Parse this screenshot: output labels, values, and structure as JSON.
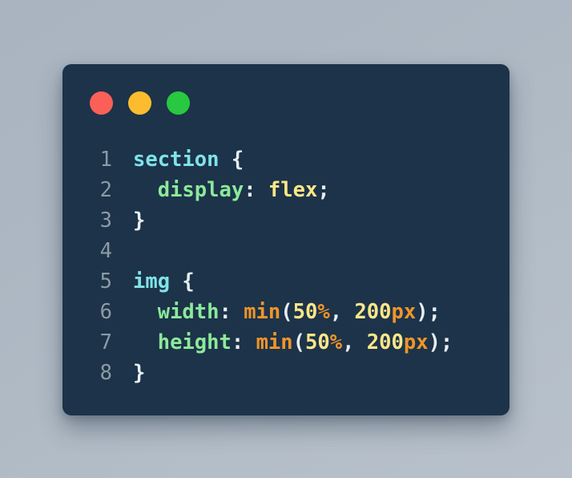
{
  "window": {
    "controls": [
      {
        "name": "close",
        "color": "#fb6058"
      },
      {
        "name": "minimize",
        "color": "#fdbc2e"
      },
      {
        "name": "zoom",
        "color": "#28c840"
      }
    ],
    "background": "#1c3349"
  },
  "theme": {
    "page_gradient_from": "#a9b4c0",
    "page_gradient_to": "#b8c1cb",
    "gutter_color": "#8c9aa5",
    "selector_color": "#7fe3e8",
    "property_color": "#8ce99a",
    "value_color": "#fde68a",
    "function_color": "#f0942a",
    "punctuation_color": "#e8edf2"
  },
  "code": {
    "language": "css",
    "lines": [
      {
        "number": "1",
        "tokens": [
          {
            "text": "section",
            "type": "sel"
          },
          {
            "text": " ",
            "type": "punc"
          },
          {
            "text": "{",
            "type": "punc"
          }
        ]
      },
      {
        "number": "2",
        "tokens": [
          {
            "text": "  ",
            "type": "punc"
          },
          {
            "text": "display",
            "type": "prop"
          },
          {
            "text": ": ",
            "type": "punc"
          },
          {
            "text": "flex",
            "type": "val"
          },
          {
            "text": ";",
            "type": "punc"
          }
        ]
      },
      {
        "number": "3",
        "tokens": [
          {
            "text": "}",
            "type": "punc"
          }
        ]
      },
      {
        "number": "4",
        "tokens": []
      },
      {
        "number": "5",
        "tokens": [
          {
            "text": "img",
            "type": "sel"
          },
          {
            "text": " ",
            "type": "punc"
          },
          {
            "text": "{",
            "type": "punc"
          }
        ]
      },
      {
        "number": "6",
        "tokens": [
          {
            "text": "  ",
            "type": "punc"
          },
          {
            "text": "width",
            "type": "prop"
          },
          {
            "text": ": ",
            "type": "punc"
          },
          {
            "text": "min",
            "type": "fn"
          },
          {
            "text": "(",
            "type": "punc"
          },
          {
            "text": "50",
            "type": "val"
          },
          {
            "text": "%",
            "type": "fn"
          },
          {
            "text": ", ",
            "type": "punc"
          },
          {
            "text": "200",
            "type": "val"
          },
          {
            "text": "px",
            "type": "fn"
          },
          {
            "text": ")",
            "type": "punc"
          },
          {
            "text": ";",
            "type": "punc"
          }
        ]
      },
      {
        "number": "7",
        "tokens": [
          {
            "text": "  ",
            "type": "punc"
          },
          {
            "text": "height",
            "type": "prop"
          },
          {
            "text": ": ",
            "type": "punc"
          },
          {
            "text": "min",
            "type": "fn"
          },
          {
            "text": "(",
            "type": "punc"
          },
          {
            "text": "50",
            "type": "val"
          },
          {
            "text": "%",
            "type": "fn"
          },
          {
            "text": ", ",
            "type": "punc"
          },
          {
            "text": "200",
            "type": "val"
          },
          {
            "text": "px",
            "type": "fn"
          },
          {
            "text": ")",
            "type": "punc"
          },
          {
            "text": ";",
            "type": "punc"
          }
        ]
      },
      {
        "number": "8",
        "tokens": [
          {
            "text": "}",
            "type": "punc"
          }
        ]
      }
    ]
  }
}
